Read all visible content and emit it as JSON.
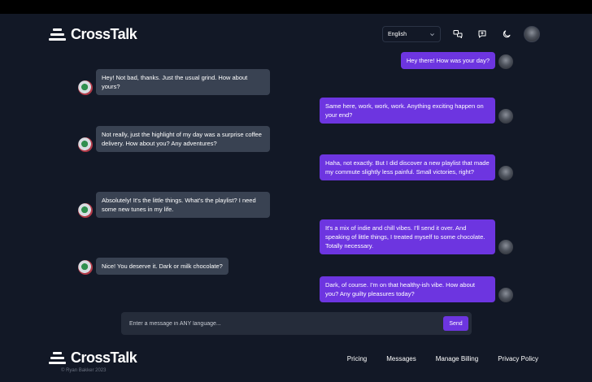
{
  "header": {
    "brand": "CrossTalk",
    "language": "English"
  },
  "messages": [
    {
      "side": "right",
      "text": "Hey there! How was your day?"
    },
    {
      "side": "left",
      "text": "Hey! Not bad, thanks. Just the usual grind. How about yours?"
    },
    {
      "side": "right",
      "text": "Same here, work, work, work. Anything exciting happen on your end?"
    },
    {
      "side": "left",
      "text": "Not really, just the highlight of my day was a surprise coffee delivery. How about you? Any adventures?"
    },
    {
      "side": "right",
      "text": "Haha, not exactly. But I did discover a new playlist that made my commute slightly less painful. Small victories, right?"
    },
    {
      "side": "left",
      "text": "Absolutely! It's the little things. What's the playlist? I need some new tunes in my life."
    },
    {
      "side": "right",
      "text": "It's a mix of indie and chill vibes. I'll send it over. And speaking of little things, I treated myself to some chocolate. Totally necessary."
    },
    {
      "side": "left",
      "text": "Nice! You deserve it. Dark or milk chocolate?"
    },
    {
      "side": "right",
      "text": "Dark, of course. I'm on that healthy-ish vibe. How about you? Any guilty pleasures today?"
    }
  ],
  "composer": {
    "placeholder": "Enter a message in ANY language...",
    "send_label": "Send"
  },
  "footer": {
    "brand": "CrossTalk",
    "links": [
      "Pricing",
      "Messages",
      "Manage Billing",
      "Privacy Policy"
    ],
    "copyright": "© Ryan Bakker 2023"
  }
}
